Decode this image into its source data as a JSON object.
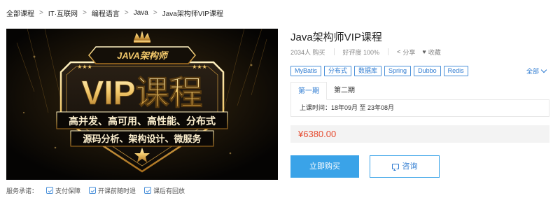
{
  "breadcrumb": {
    "items": [
      "全部课程",
      "IT·互联网",
      "编程语言",
      "Java",
      "Java架构师VIP课程"
    ],
    "separator": ">"
  },
  "banner": {
    "brand_text": "JAVA架构师",
    "headline": "VIP课程",
    "line1": "高并发、高可用、高性能、分布式",
    "line2": "源码分析、架构设计、微服务",
    "colors": {
      "gold": "#f3c96b",
      "background": "#070604"
    }
  },
  "service": {
    "label": "服务承诺：",
    "items": [
      {
        "label": "支付保障",
        "icon": "shield-check-icon"
      },
      {
        "label": "开课前随时退",
        "icon": "refund-icon"
      },
      {
        "label": "课后有回放",
        "icon": "replay-icon"
      }
    ]
  },
  "course": {
    "title": "Java架构师VIP课程",
    "buyers": "2034人 购买",
    "rating": "好评度 100%",
    "share": "分享",
    "favorite": "收藏",
    "tags": [
      "MyBatis",
      "分布式",
      "数据库",
      "Spring",
      "Dubbo",
      "Redis"
    ],
    "all_label": "全部",
    "periods": [
      "第一期",
      "第二期"
    ],
    "active_period": 0,
    "schedule": "上课时间：18年09月 至 23年08月",
    "price": "¥6380.00"
  },
  "actions": {
    "buy_label": "立即购买",
    "consult_label": "咨询"
  },
  "theme": {
    "accent": "#3aa3e8",
    "link": "#2e7bd1",
    "price": "#e64a2e"
  }
}
